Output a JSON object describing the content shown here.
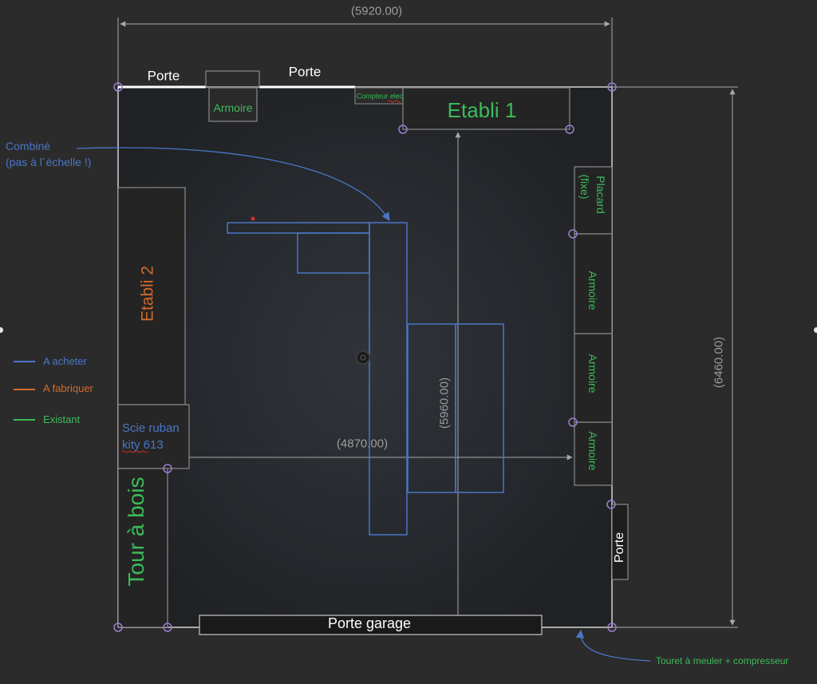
{
  "colors": {
    "background": "#2b2b2b",
    "room": "#26282b",
    "wall": "#a8a8a8",
    "acheter": "#4a76c6",
    "fabriquer": "#d2692a",
    "existant": "#3dba5a",
    "dimension": "#9c9c9c",
    "vertex": "#9a7fd1"
  },
  "dimensions": {
    "top": "(5920.00)",
    "right": "(6460.00)",
    "center_vertical": "(5960.00)",
    "center_horizontal": "(4870.00)"
  },
  "labels": {
    "porte_left": "Porte",
    "porte_right": "Porte",
    "armoire_top": "Armoire",
    "compteur": "Compteur elec",
    "etabli1": "Etabli 1",
    "combine_line1": "Combiné",
    "combine_line2": "(pas à l´échelle !)",
    "placard_line1": "Placard",
    "placard_line2": "(fixe)",
    "armoire_r1": "Armoire",
    "armoire_r2": "Armoire",
    "armoire_r3": "Armoire",
    "etabli2": "Etabli 2",
    "scie_line1": "Scie ruban",
    "scie_line2": "kity 613",
    "tour": "Tour à bois",
    "porte_side": "Porte",
    "porte_garage": "Porte garage",
    "touret": "Touret à meuler + compresseur"
  },
  "legend": [
    {
      "label": "A acheter",
      "color": "#4a76c6"
    },
    {
      "label": "A fabriquer",
      "color": "#d2692a"
    },
    {
      "label": "Existant",
      "color": "#3dba5a"
    }
  ]
}
